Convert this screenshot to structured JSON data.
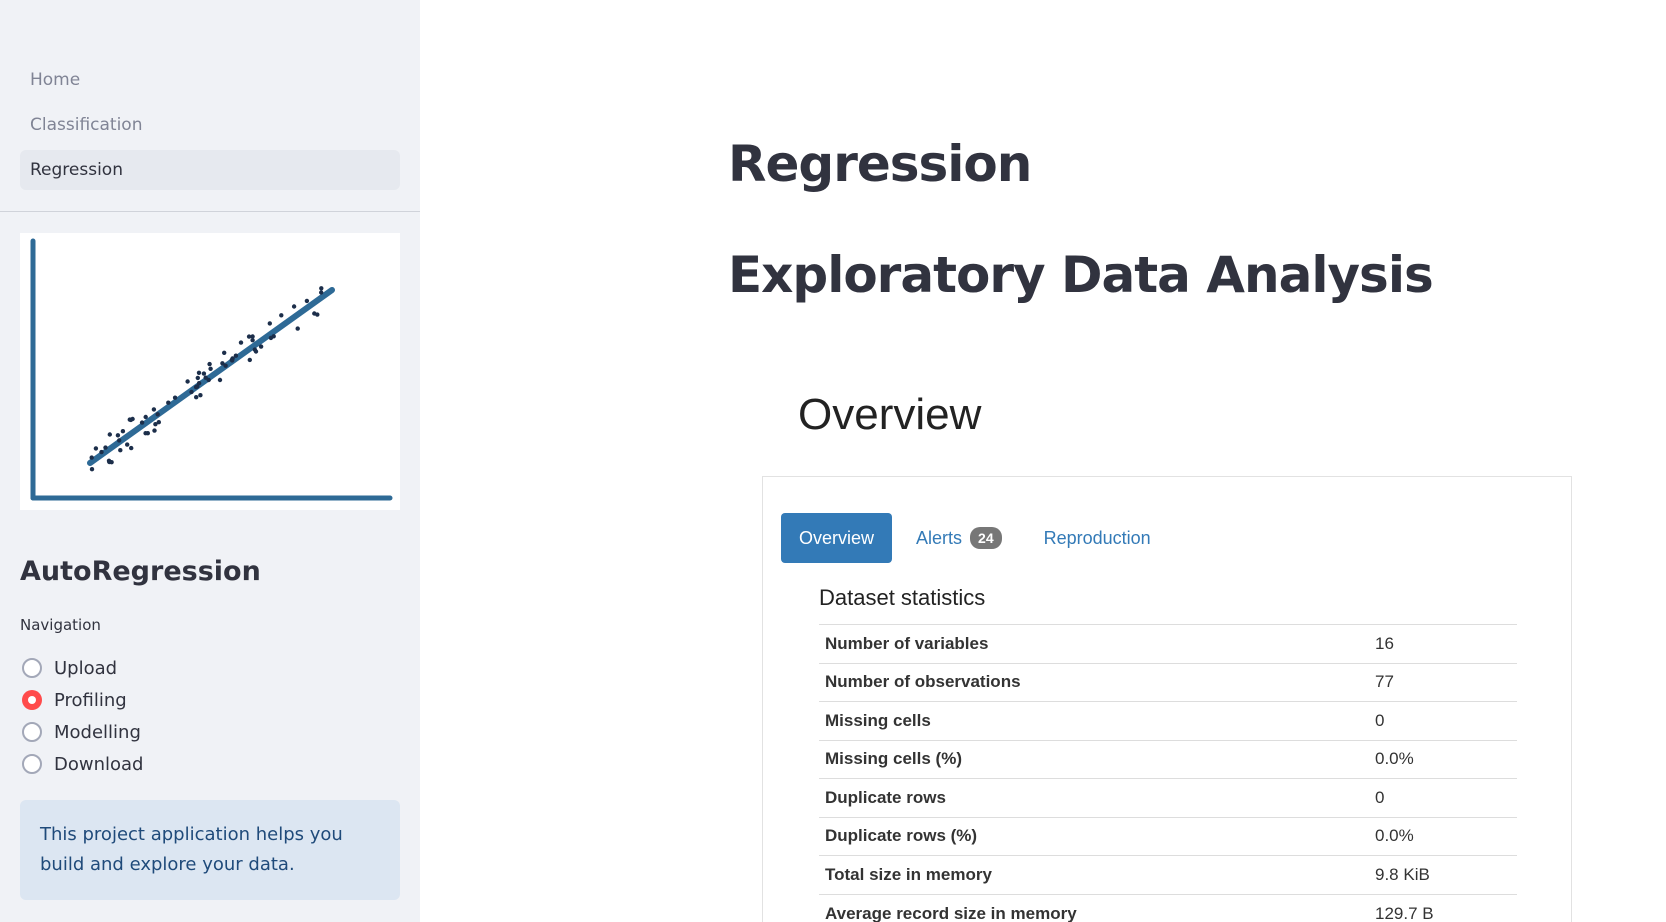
{
  "sidebar": {
    "nav": [
      {
        "label": "Home",
        "active": false
      },
      {
        "label": "Classification",
        "active": false
      },
      {
        "label": "Regression",
        "active": true
      }
    ],
    "logo_icon": "scatter-regression-logo",
    "app_title": "AutoRegression",
    "navigation_caption": "Navigation",
    "radio_options": [
      {
        "label": "Upload",
        "selected": false
      },
      {
        "label": "Profiling",
        "selected": true
      },
      {
        "label": "Modelling",
        "selected": false
      },
      {
        "label": "Download",
        "selected": false
      }
    ],
    "info_text": "This project application helps you build and explore your data."
  },
  "main": {
    "title": "Regression",
    "subtitle": "Exploratory Data Analysis",
    "report": {
      "section_title": "Overview",
      "tabs": [
        {
          "label": "Overview",
          "active": true
        },
        {
          "label": "Alerts",
          "badge": "24",
          "active": false
        },
        {
          "label": "Reproduction",
          "active": false
        }
      ],
      "stats_title": "Dataset statistics",
      "stats": [
        {
          "key": "Number of variables",
          "value": "16"
        },
        {
          "key": "Number of observations",
          "value": "77"
        },
        {
          "key": "Missing cells",
          "value": "0"
        },
        {
          "key": "Missing cells (%)",
          "value": "0.0%"
        },
        {
          "key": "Duplicate rows",
          "value": "0"
        },
        {
          "key": "Duplicate rows (%)",
          "value": "0.0%"
        },
        {
          "key": "Total size in memory",
          "value": "9.8 KiB"
        },
        {
          "key": "Average record size in memory",
          "value": "129.7 B"
        }
      ]
    }
  },
  "colors": {
    "sidebar_bg": "#f0f2f6",
    "accent_red": "#ff4b4b",
    "tab_blue": "#337ab7",
    "info_bg": "#dce6f2"
  }
}
